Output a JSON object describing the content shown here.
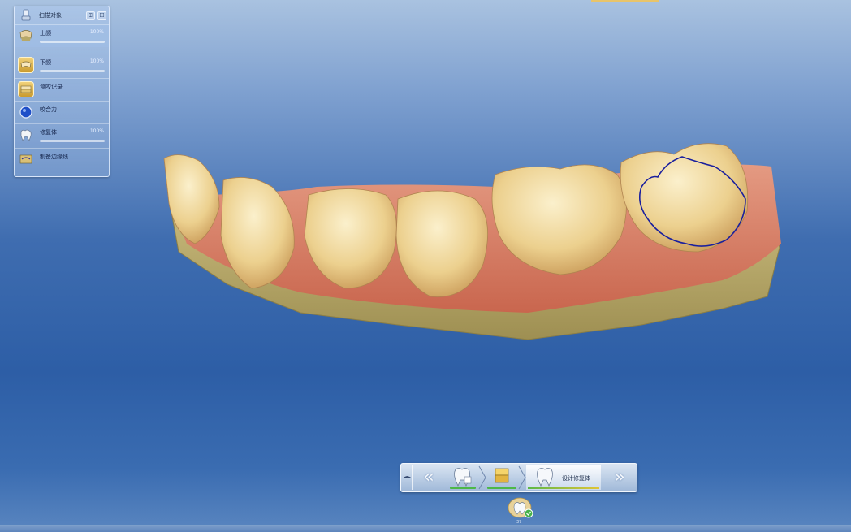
{
  "object_panel": {
    "title": "扫描对象",
    "header_buttons": [
      "⍐",
      "☐"
    ],
    "items": [
      {
        "label": "上颌",
        "percent": "100%",
        "icon": "upper-jaw-icon",
        "selected": true
      },
      {
        "label": "下颌",
        "percent": "100%",
        "icon": "lower-jaw-icon",
        "selected": false
      },
      {
        "label": "食咬记录",
        "percent": "",
        "icon": "bite-registration-icon",
        "selected": false
      },
      {
        "label": "咬合力",
        "percent": "",
        "icon": "occlusion-icon",
        "selected": false
      },
      {
        "label": "修复体",
        "percent": "100%",
        "icon": "restoration-icon",
        "selected": false
      },
      {
        "label": "制备边缘线",
        "percent": "",
        "icon": "margin-line-icon",
        "selected": false
      }
    ]
  },
  "phase_bar": {
    "handle": "◄►",
    "prev": "«",
    "next": "»",
    "steps": [
      {
        "name": "administration-step",
        "label": "",
        "status": "done"
      },
      {
        "name": "acquisition-step",
        "label": "",
        "status": "done"
      },
      {
        "name": "model-step",
        "label": "设计修复体",
        "status": "active"
      }
    ]
  },
  "bottom_icon": {
    "label": "37",
    "icon": "tooth-check-icon"
  },
  "colors": {
    "accent_green": "#4db848",
    "accent_gold": "#e1c537",
    "margin_line": "#1a1f9e",
    "gingiva": "#d9785f",
    "tooth": "#f0d49a",
    "base": "#b8a968"
  }
}
